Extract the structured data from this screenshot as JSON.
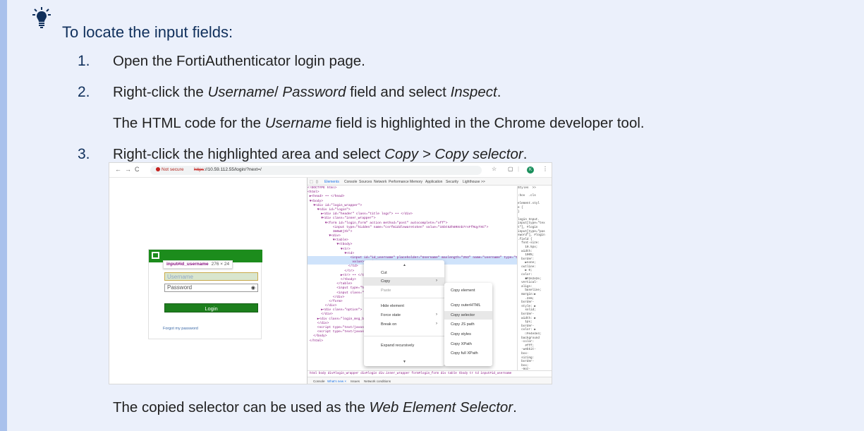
{
  "tip": {
    "title": "To locate the input fields:",
    "icon": "lightbulb-icon",
    "accent": "#a9c1ec",
    "background": "#ebf0fb"
  },
  "steps": [
    {
      "num": "1.",
      "text": "Open the FortiAuthenticator login page."
    },
    {
      "num": "2.",
      "pre": "Right-click the ",
      "em1": "Username",
      "mid1": "/ ",
      "em2": "Password",
      "mid2": " field and select ",
      "em3": "Inspect",
      "post": "."
    },
    {
      "sub_pre": "The HTML code for the ",
      "sub_em": "Username",
      "sub_post": " field is highlighted in the Chrome developer tool."
    },
    {
      "num": "3.",
      "pre": "Right-click the highlighted area and select ",
      "em": "Copy > Copy selector",
      "post": "."
    }
  ],
  "closing": {
    "pre": "The copied selector can be used as the ",
    "em": "Web Element Selector",
    "post": "."
  },
  "screenshot": {
    "browser": {
      "not_secure": "Not secure",
      "url_scheme": "https",
      "url_rest": "://10.59.112.55/login/?next=/",
      "profile_initial": "K"
    },
    "login": {
      "tooltip_selector": "input#id_username",
      "tooltip_size": "276 × 24",
      "username_placeholder": "Username",
      "password_placeholder": "Password",
      "login_button": "Login",
      "forgot_link": "Forgot my password"
    },
    "devtools": {
      "tabs": [
        "Elements",
        "Console",
        "Sources",
        "Network",
        "Performance",
        "Memory",
        "Application",
        "Security",
        "Lighthouse",
        ">>"
      ],
      "dom_lines": [
        "<!DOCTYPE html>",
        "<html>",
        " ▶<head> •• </head>",
        " ▼<body>",
        "   ▼<div id=\"login_wrapper\">",
        "     ▼<div id=\"login\">",
        "       ▶<div id=\"header\" class=\"title logo\"> •• </div>",
        "       ▼<div class=\"inner_wrapper\">",
        "         ▼<form id=\"login_form\" action method=\"post\" autocomplete=\"off\">",
        "             <input type=\"hidden\" name=\"csrfmiddlewaretoken\" value=\"15bt5Zh6RXnb7rsFfRqyTXC\">",
        "             3m0wEjtk\">",
        "           ▼<div>",
        "             ▼<table>",
        "               ▼<tbody>",
        "                 ▼<tr>",
        "                   ▼<td>",
        "                      <input id=\"id_username\" placeholder=\"Username\" maxlength=\"253\" name=\"username\" type=\"text\"",
        "                       value> == $0",
        "                     </td>",
        "                   </tr>",
        "                 ▶<tr> •• </tr>",
        "                 </tbody>",
        "               </table>",
        "               <input type=\"hidden\"",
        "               <input class=\"subm",
        "             </div>",
        "           </form>",
        "         </div>",
        "       ▶<div class=\"option\"> •• <",
        "       </div>",
        "     ▶<div class=\"login_msg_bar\"",
        "     </div>",
        "     <script type=\"text/javascript",
        "     <script type=\"text/javascript",
        "   </body>",
        " </html>"
      ],
      "styles_lines": [
        "Styles  >>",
        "",
        ":hov  .cls",
        "",
        "element.styl",
        "e {",
        "}",
        "",
        "login Input.",
        "input[type=\"tex",
        "t\"], #login",
        "input[type=\"pas",
        "sword\"], #login",
        ".field {",
        "  font-size:",
        "    10.5px;",
        "  width:",
        "    100%;",
        "  border:",
        "    ▶none;",
        "  outline:",
        "    ▶ 0;",
        "  color:",
        "    ■#2e2e2e;",
        "  vertical-",
        "  align:",
        "    baseline;",
        "  margin:▶",
        "    .2em;",
        "  border-",
        "  style: ▶",
        "    solid;",
        "  border-",
        "  width: ▶",
        "    1px;",
        "  border-",
        "  color: ▶",
        "    □#e4e4e4;",
        "  background",
        "  -color:",
        "    #fff;",
        "  -webkit-",
        "  box-",
        "  sizing:",
        "  border-",
        "  box;",
        "  -moz-",
        "  sizing:",
        "  border-",
        "  box;",
        "  box-sizing",
        "  :",
        "    border-"
      ],
      "breadcrumb": "html  body  div#login_wrapper  div#login  div.inner_wrapper  form#login_form  div  table  tbody  tr  td  input#id_username",
      "drawer": [
        "Console",
        "What's new ×",
        "Issues",
        "Network conditions"
      ]
    },
    "context_menu": {
      "items": [
        "Cut",
        "Copy",
        "Paste",
        "Hide element",
        "Force state",
        "Break on",
        "Expand recursively"
      ],
      "submenu": [
        "Copy element",
        "Copy outerHTML",
        "Copy selector",
        "Copy JS path",
        "Copy styles",
        "Copy XPath",
        "Copy full XPath"
      ]
    }
  }
}
